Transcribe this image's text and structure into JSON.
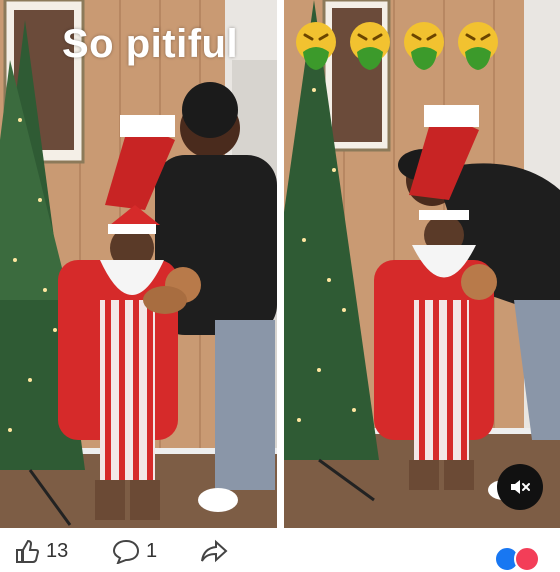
{
  "caption": "So pitiful",
  "emojis": [
    "nauseated-face",
    "nauseated-face",
    "nauseated-face",
    "nauseated-face"
  ],
  "controls": {
    "mute_icon": "speaker-muted-icon"
  },
  "stats": {
    "likes": "13",
    "comments": "1"
  },
  "colors": {
    "wall": "#c99a73",
    "santa_red": "#d62a2a",
    "tree": "#2f5b34",
    "emoji": "#f2c230"
  }
}
